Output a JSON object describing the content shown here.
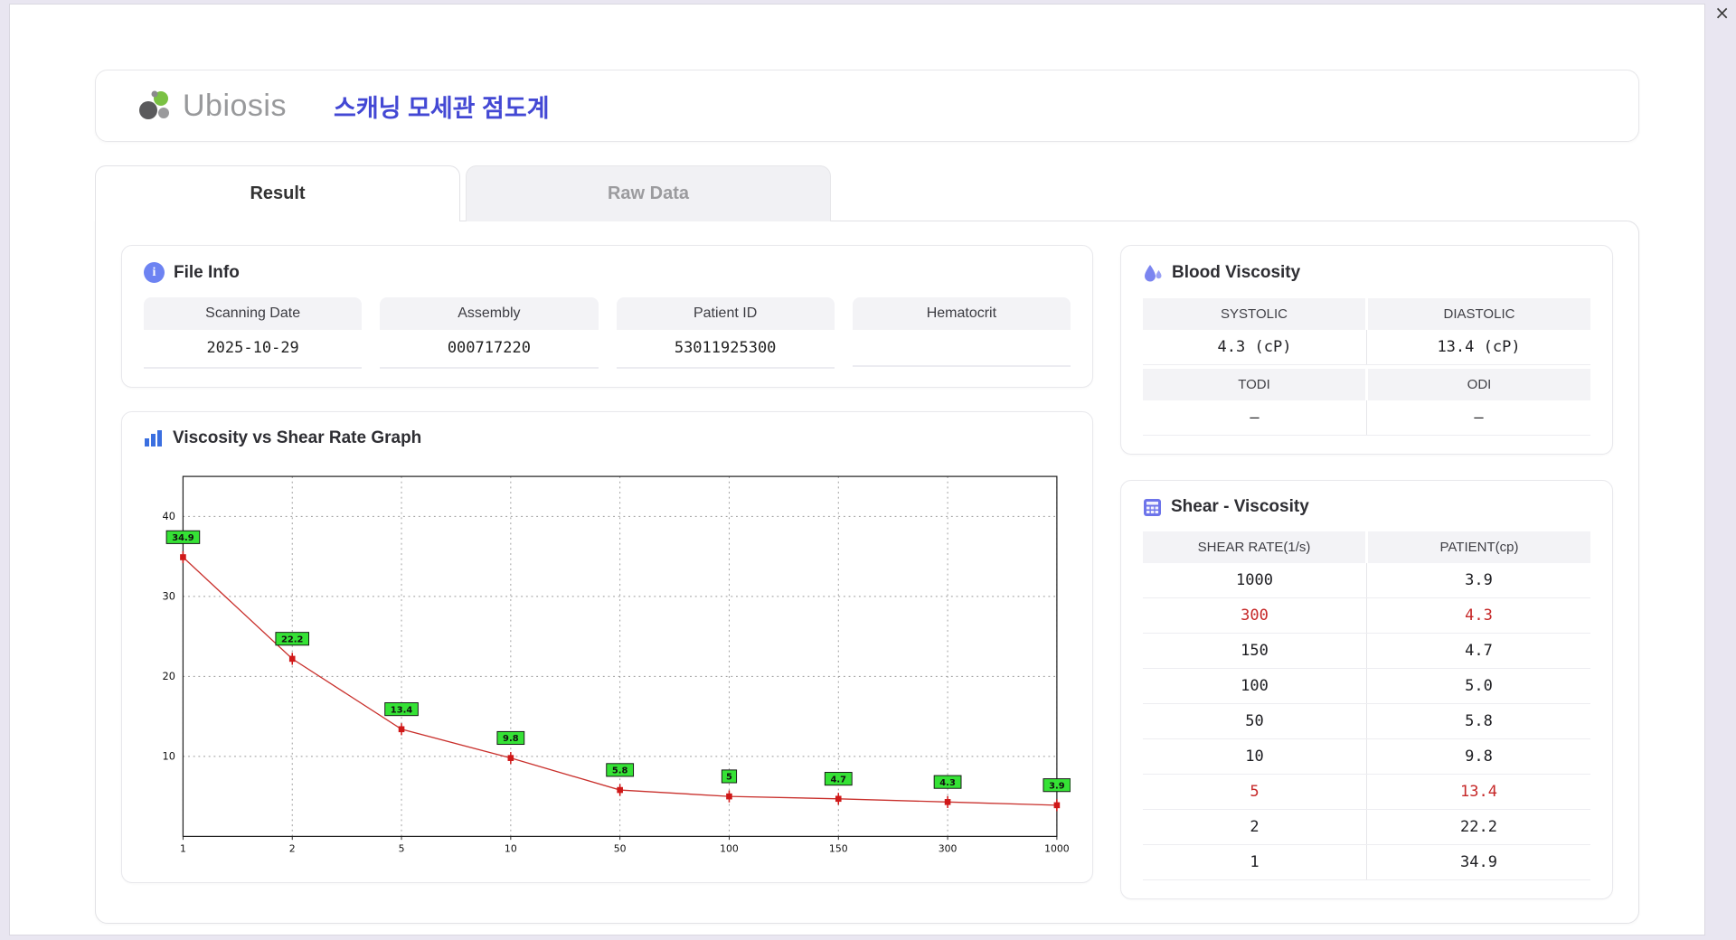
{
  "window": {
    "close_icon": "×"
  },
  "header": {
    "logo_text": "Ubiosis",
    "title": "스캐닝 모세관 점도계"
  },
  "tabs": [
    {
      "label": "Result",
      "active": true
    },
    {
      "label": "Raw Data",
      "active": false
    }
  ],
  "file_info": {
    "title": "File Info",
    "fields": [
      {
        "label": "Scanning Date",
        "value": "2025-10-29"
      },
      {
        "label": "Assembly",
        "value": "000717220"
      },
      {
        "label": "Patient ID",
        "value": "53011925300"
      },
      {
        "label": "Hematocrit",
        "value": ""
      }
    ]
  },
  "blood_viscosity": {
    "title": "Blood Viscosity",
    "sections": [
      {
        "headers": [
          "SYSTOLIC",
          "DIASTOLIC"
        ],
        "values": [
          "4.3 (cP)",
          "13.4 (cP)"
        ]
      },
      {
        "headers": [
          "TODI",
          "ODI"
        ],
        "values": [
          "–",
          "–"
        ]
      }
    ]
  },
  "shear_viscosity": {
    "title": "Shear - Viscosity",
    "columns": [
      "SHEAR RATE(1/s)",
      "PATIENT(cp)"
    ],
    "rows": [
      {
        "rate": "1000",
        "patient": "3.9",
        "highlight": false
      },
      {
        "rate": "300",
        "patient": "4.3",
        "highlight": true
      },
      {
        "rate": "150",
        "patient": "4.7",
        "highlight": false
      },
      {
        "rate": "100",
        "patient": "5.0",
        "highlight": false
      },
      {
        "rate": "50",
        "patient": "5.8",
        "highlight": false
      },
      {
        "rate": "10",
        "patient": "9.8",
        "highlight": false
      },
      {
        "rate": "5",
        "patient": "13.4",
        "highlight": true
      },
      {
        "rate": "2",
        "patient": "22.2",
        "highlight": false
      },
      {
        "rate": "1",
        "patient": "34.9",
        "highlight": false
      }
    ]
  },
  "chart_data": {
    "type": "line",
    "title": "Viscosity vs Shear Rate Graph",
    "categories": [
      "1",
      "2",
      "5",
      "10",
      "50",
      "100",
      "150",
      "300",
      "1000"
    ],
    "values": [
      34.9,
      22.2,
      13.4,
      9.8,
      5.8,
      5,
      4.7,
      4.3,
      3.9
    ],
    "point_labels": [
      "34.9",
      "22.2",
      "13.4",
      "9.8",
      "5.8",
      "5",
      "4.7",
      "4.3",
      "3.9"
    ],
    "xlabel": "",
    "ylabel": "",
    "x_scale": "category",
    "y_ticks": [
      10,
      20,
      30,
      40
    ],
    "ylim": [
      0,
      45
    ],
    "grid": "dashed",
    "legend": "none",
    "line_color": "#c9302c",
    "marker_color": "#d01818",
    "point_label_bg": "#35e235",
    "highlight_color": "#c62828"
  },
  "colors": {
    "accent_blue": "#4348d4",
    "icon_purple": "#6d7df0",
    "logo_green": "#7ac143",
    "highlight_red": "#c62828"
  }
}
